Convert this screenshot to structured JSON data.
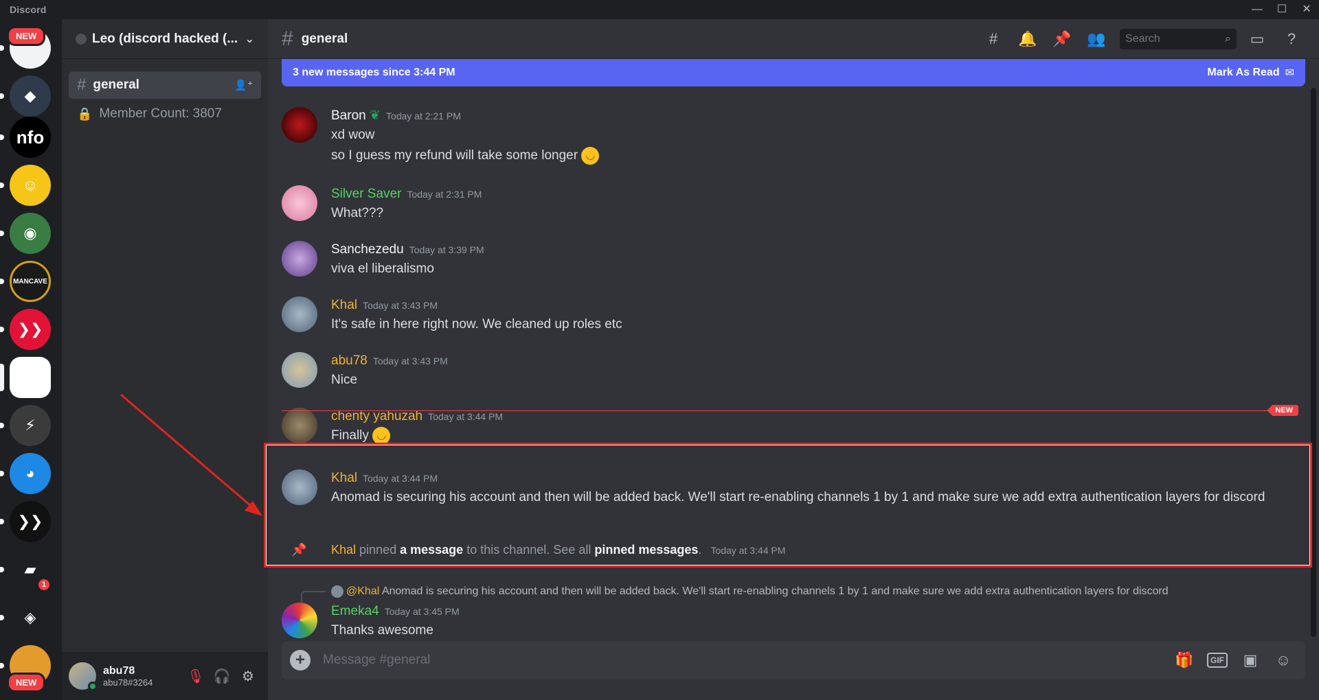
{
  "app": {
    "title": "Discord"
  },
  "window": {
    "minimize": "—",
    "maximize": "☐",
    "close": "✕"
  },
  "rail": {
    "servers": [
      {
        "name": "server-1",
        "glyph": "",
        "color": "#f2f3f5"
      },
      {
        "name": "server-2",
        "glyph": "◆",
        "color": "#2f3a4a"
      },
      {
        "name": "server-nfo",
        "glyph": "nfo",
        "color": "#000000"
      },
      {
        "name": "server-4",
        "glyph": "☺",
        "color": "#f5c518"
      },
      {
        "name": "server-5",
        "glyph": "◉",
        "color": "#3a7d44"
      },
      {
        "name": "server-mancave",
        "glyph": "MANCAVE",
        "color": "#1a1a1a"
      },
      {
        "name": "server-hive",
        "glyph": "❯❯",
        "color": "#e31337"
      },
      {
        "name": "server-current",
        "glyph": "",
        "color": "#ffffff"
      },
      {
        "name": "server-9",
        "glyph": "⚡",
        "color": "#3b3b3b"
      },
      {
        "name": "server-10",
        "glyph": "◕",
        "color": "#1e88e5"
      },
      {
        "name": "server-11",
        "glyph": "❯❯",
        "color": "#111111"
      },
      {
        "name": "server-12",
        "glyph": "▰",
        "color": "#1e1f22"
      },
      {
        "name": "server-13",
        "glyph": "◈",
        "color": "#1e1f22"
      },
      {
        "name": "server-14",
        "glyph": "",
        "color": "#e39b2b"
      }
    ],
    "new_label_top": "NEW",
    "new_label_bottom": "NEW",
    "mention_count": "1"
  },
  "sidebar": {
    "guild_name": "Leo (discord hacked (...",
    "channels": [
      {
        "label": "general",
        "icon": "#"
      },
      {
        "label": "Member Count: 3807",
        "icon": "lock-icon"
      }
    ],
    "user": {
      "name": "abu78",
      "tag": "abu78#3264"
    }
  },
  "header": {
    "channel": "general",
    "search_placeholder": "Search"
  },
  "banner": {
    "text": "3 new messages since 3:44 PM",
    "action": "Mark As Read"
  },
  "messages": [
    {
      "author": "Baron",
      "color": "#f2f3f5",
      "time": "Today at 2:21 PM",
      "lines": [
        "xd wow",
        "so I guess my refund will take some longer"
      ]
    },
    {
      "author": "Silver Saver",
      "color": "#57d163",
      "time": "Today at 2:31 PM",
      "lines": [
        "What???"
      ]
    },
    {
      "author": "Sanchezedu",
      "color": "#f2f3f5",
      "time": "Today at 3:39 PM",
      "lines": [
        "viva el liberalismo"
      ]
    },
    {
      "author": "Khal",
      "color": "#f0b232",
      "time": "Today at 3:43 PM",
      "lines": [
        "It's safe in here right now. We cleaned up roles etc"
      ]
    },
    {
      "author": "abu78",
      "color": "#f0b232",
      "time": "Today at 3:43 PM",
      "lines": [
        "Nice"
      ]
    },
    {
      "author": "chenty yahuzah",
      "color": "#f0b232",
      "time": "Today at 3:44 PM",
      "lines": [
        "Finally"
      ]
    },
    {
      "author": "Khal",
      "color": "#f0b232",
      "time": "Today at 3:44 PM",
      "lines": [
        "Anomad is securing his account and then will be added back. We'll start re-enabling channels 1 by 1 and make sure we add extra authentication layers for discord"
      ]
    },
    {
      "author": "Emeka4",
      "color": "#57d163",
      "time": "Today at 3:45 PM",
      "lines": [
        "Thanks awesome"
      ]
    }
  ],
  "new_divider": "NEW",
  "pin_notice": {
    "author": "Khal",
    "pre": "pinned",
    "link1": "a message",
    "mid": "to this channel. See all",
    "link2": "pinned messages",
    "post": ".",
    "time": "Today at 3:44 PM"
  },
  "reply_preview": {
    "mention": "@Khal",
    "text": "Anomad is securing his account and then will be added back. We'll start re-enabling channels 1 by 1 and make sure we add extra authentication layers for discord"
  },
  "composer": {
    "placeholder": "Message #general",
    "gif": "GIF"
  }
}
